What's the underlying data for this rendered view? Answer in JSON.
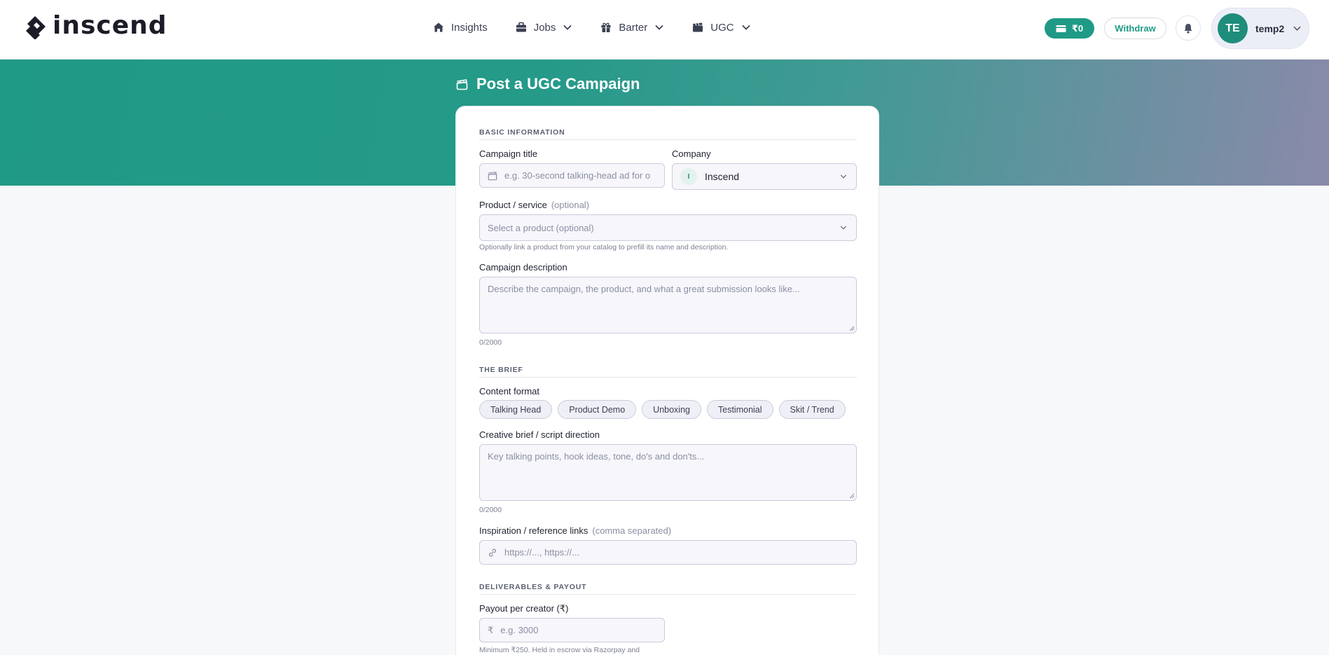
{
  "brand": {
    "name": "inscend"
  },
  "nav": [
    {
      "label": "Insights",
      "icon": "home-icon",
      "dropdown": false
    },
    {
      "label": "Jobs",
      "icon": "briefcase-icon",
      "dropdown": true
    },
    {
      "label": "Barter",
      "icon": "gift-icon",
      "dropdown": true
    },
    {
      "label": "UGC",
      "icon": "clapperboard-icon",
      "dropdown": true
    }
  ],
  "header": {
    "wallet_balance": "₹0",
    "withdraw_label": "Withdraw",
    "user_initials": "TE",
    "user_name": "temp2"
  },
  "page": {
    "title": "Post a UGC Campaign"
  },
  "form": {
    "basic": {
      "heading": "BASIC INFORMATION",
      "title_label": "Campaign title",
      "title_placeholder": "e.g. 30-second talking-head ad for o",
      "company_label": "Company",
      "company_initial": "I",
      "company_value": "Inscend",
      "product_label": "Product / service",
      "product_optional": "(optional)",
      "product_placeholder": "Select a product (optional)",
      "product_help": "Optionally link a product from your catalog to prefill its name and description.",
      "desc_label": "Campaign description",
      "desc_placeholder": "Describe the campaign, the product, and what a great submission looks like...",
      "desc_count": "0/2000"
    },
    "brief": {
      "heading": "THE BRIEF",
      "format_label": "Content format",
      "formats": [
        "Talking Head",
        "Product Demo",
        "Unboxing",
        "Testimonial",
        "Skit / Trend"
      ],
      "script_label": "Creative brief / script direction",
      "script_placeholder": "Key talking points, hook ideas, tone, do's and don'ts...",
      "script_count": "0/2000",
      "links_label": "Inspiration / reference links",
      "links_hint": "(comma separated)",
      "links_placeholder": "https://..., https://..."
    },
    "payout": {
      "heading": "DELIVERABLES & PAYOUT",
      "payout_label": "Payout per creator (₹)",
      "payout_placeholder": "e.g. 3000",
      "payout_help": "Minimum ₹250. Held in escrow via Razorpay and"
    }
  },
  "colors": {
    "brand": "#1f9a86",
    "gradient_end": "#8a8aaa"
  }
}
